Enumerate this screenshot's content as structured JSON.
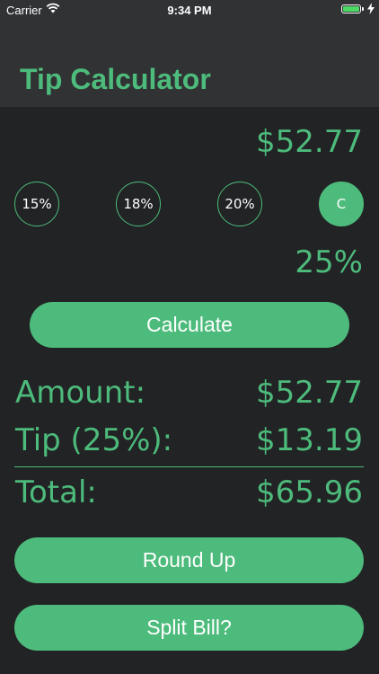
{
  "status_bar": {
    "carrier": "Carrier",
    "time": "9:34 PM",
    "battery_color": "#4cd964"
  },
  "header": {
    "title": "Tip Calculator"
  },
  "bill_amount": "$52.77",
  "tip_buttons": [
    {
      "label": "15%",
      "selected": false
    },
    {
      "label": "18%",
      "selected": false
    },
    {
      "label": "20%",
      "selected": false
    },
    {
      "label": "C",
      "selected": true
    }
  ],
  "custom_percent": "25%",
  "calculate_label": "Calculate",
  "results": {
    "amount_label": "Amount:",
    "amount_value": "$52.77",
    "tip_label": "Tip (25%):",
    "tip_value": "$13.19",
    "total_label": "Total:",
    "total_value": "$65.96"
  },
  "round_up_label": "Round Up",
  "split_bill_label": "Split Bill?",
  "colors": {
    "accent": "#4dbb7b",
    "background": "#222325",
    "nav_background": "#313234"
  }
}
